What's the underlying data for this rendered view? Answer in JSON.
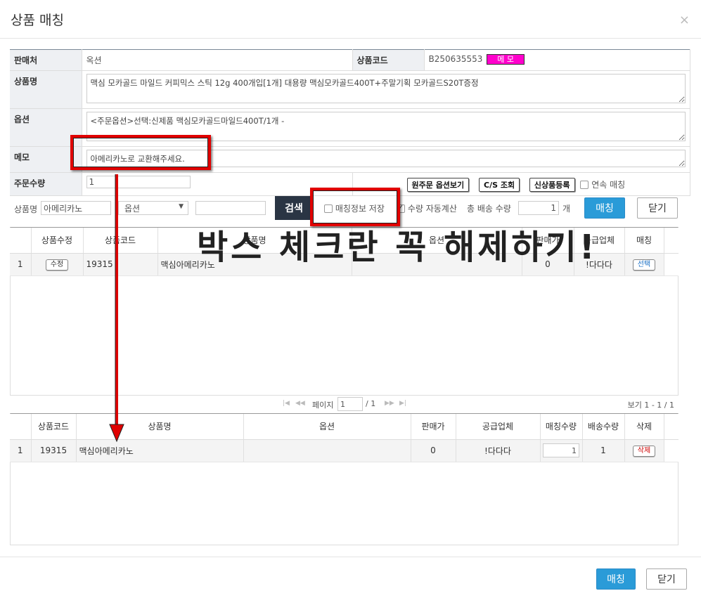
{
  "modal": {
    "title": "상품 매칭",
    "close": "×"
  },
  "info": {
    "seller_label": "판매처",
    "seller_value": "옥션",
    "code_label": "상품코드",
    "code_value": "B250635553",
    "memo_badge": "메 모",
    "name_label": "상품명",
    "name_value": "맥심 모카골드 마일드 커피믹스 스틱 12g 400개입[1개] 대용량 맥심모카골드400T+주말기획 모카골드S20T증정",
    "option_label": "옵션",
    "option_value": "<주문옵션>선택:신제품 맥심모카골드마일드400T/1개 -",
    "memo_label": "메모",
    "memo_value": "아메리카노로 교환해주세요.",
    "qty_label": "주문수량",
    "qty_value": "1",
    "btn_original_option": "원주문 옵션보기",
    "btn_cs": "C/S 조회",
    "btn_new_product": "신상품등록",
    "continuous_label": "연속 매칭"
  },
  "search": {
    "name_label": "상품명",
    "name_value": "아메리카노",
    "option_select": "옵션",
    "search_button": "검색",
    "save_match_label": "매칭정보 저장",
    "auto_qty_label": "수량 자동계산",
    "total_qty_label": "총 배송 수량",
    "total_qty_value": "1",
    "unit": "개",
    "match_button": "매칭",
    "close_button": "닫기"
  },
  "overlay": {
    "text": "박스 체크란 꼭 해제하기!"
  },
  "results": {
    "headers": [
      "상품수정",
      "상품코드",
      "상품명",
      "옵션",
      "판매가",
      "공급업체",
      "매칭"
    ],
    "rows": [
      {
        "no": "1",
        "edit": "수정",
        "code": "19315",
        "name": "맥심아메리카노",
        "option": "",
        "price": "0",
        "supplier": "!다다다",
        "select": "선택"
      }
    ]
  },
  "pager": {
    "page_label": "페이지",
    "page_value": "1",
    "total": "/ 1",
    "view": "보기 1 - 1 / 1"
  },
  "matched": {
    "headers": [
      "상품코드",
      "상품명",
      "옵션",
      "판매가",
      "공급업체",
      "매칭수량",
      "배송수량",
      "삭제"
    ],
    "rows": [
      {
        "no": "1",
        "code": "19315",
        "name": "맥심아메리카노",
        "option": "",
        "price": "0",
        "supplier": "!다다다",
        "match_qty": "1",
        "ship_qty": "1",
        "delete": "삭제"
      }
    ]
  },
  "footer": {
    "match_button": "매칭",
    "close_button": "닫기"
  },
  "colors": {
    "accent": "#2a9bd8",
    "dark": "#2a3544",
    "highlight": "#e00000",
    "memo_badge": "#ff00cc"
  }
}
